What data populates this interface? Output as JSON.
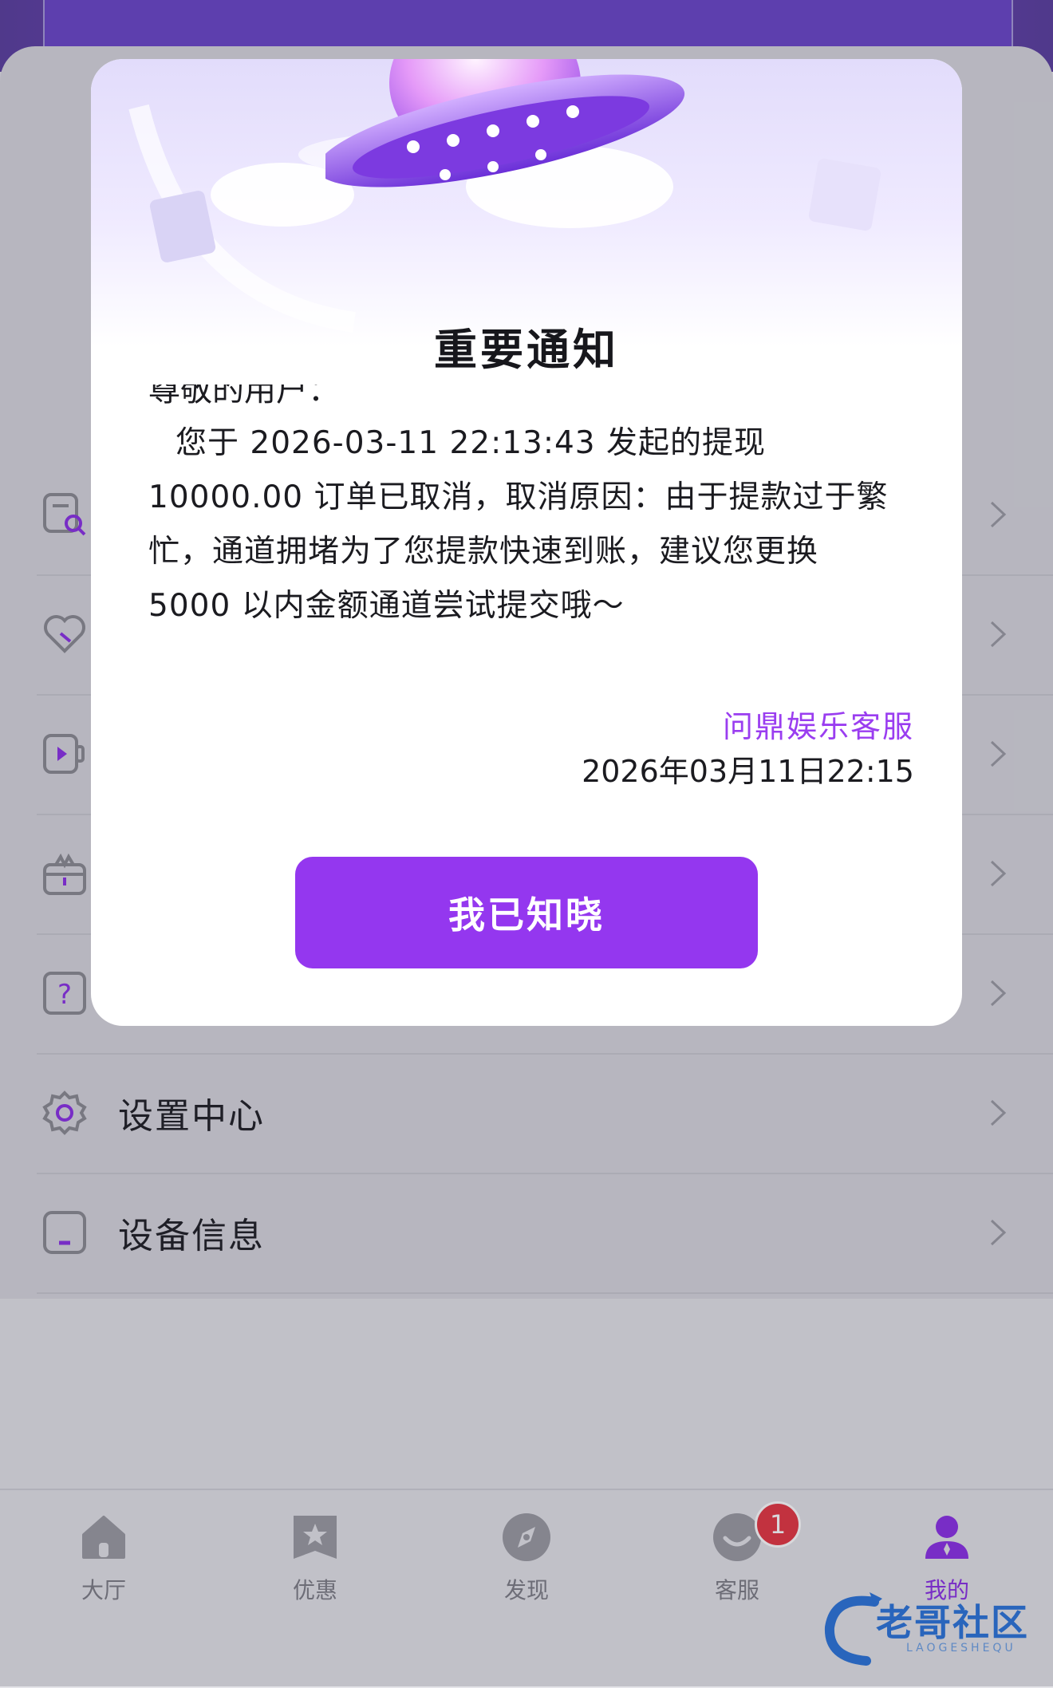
{
  "menu": {
    "items": [
      {
        "icon": "search-document-icon",
        "label": ""
      },
      {
        "icon": "heart-icon",
        "label": ""
      },
      {
        "icon": "video-icon",
        "label": ""
      },
      {
        "icon": "gift-icon",
        "label": ""
      },
      {
        "icon": "question-icon",
        "label": ""
      },
      {
        "icon": "gear-icon",
        "label": "设置中心"
      },
      {
        "icon": "device-icon",
        "label": "设备信息"
      }
    ]
  },
  "modal": {
    "title": "重要通知",
    "greeting": "尊敬的用户：",
    "message": "您于 2026-03-11 22:13:43 发起的提现 10000.00 订单已取消，取消原因：由于提款过于繁忙，通道拥堵为了您提款快速到账，建议您更换 5000 以内金额通道尝试提交哦～",
    "sender": "问鼎娱乐客服",
    "date": "2026年03月11日22:15",
    "button_label": "我已知晓"
  },
  "tabbar": {
    "tabs": [
      {
        "label": "大厅",
        "icon": "home-icon"
      },
      {
        "label": "优惠",
        "icon": "star-bookmark-icon"
      },
      {
        "label": "发现",
        "icon": "compass-icon"
      },
      {
        "label": "客服",
        "icon": "support-icon",
        "badge": "1"
      },
      {
        "label": "我的",
        "icon": "user-icon",
        "active": true
      }
    ]
  },
  "watermark": {
    "text": "老哥社区",
    "sub": "LAOGESHEQU"
  },
  "colors": {
    "accent": "#9437ef",
    "sender": "#9a3df0",
    "badge": "#e53541"
  }
}
